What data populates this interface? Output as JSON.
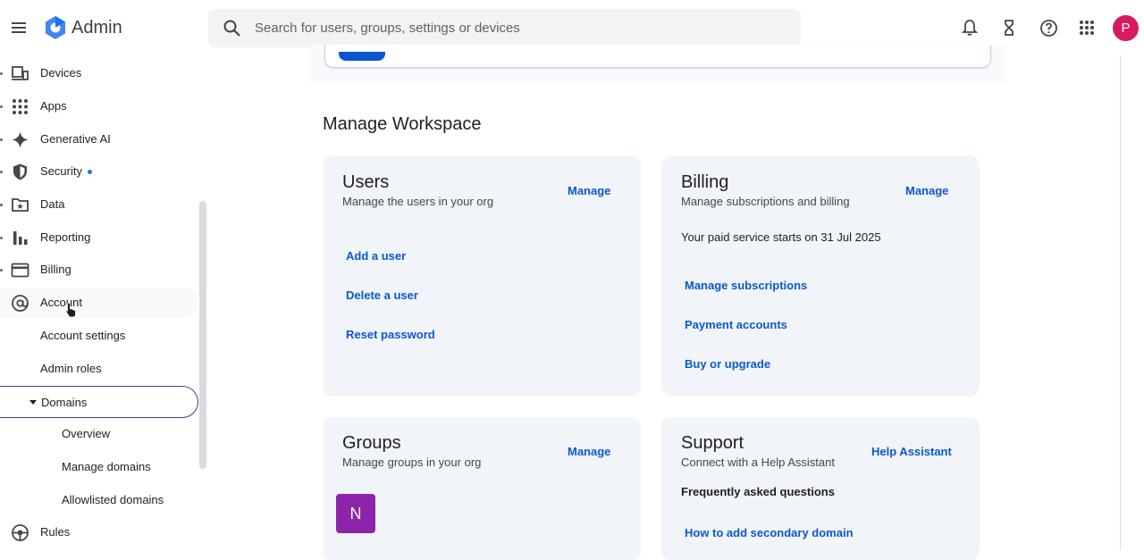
{
  "header": {
    "app_title": "Admin",
    "search_placeholder": "Search for users, groups, settings or devices",
    "avatar_initial": "P",
    "icons": [
      "menu-icon",
      "google-admin-logo",
      "search-icon",
      "bell-icon",
      "hourglass-icon",
      "help-icon",
      "apps-grid-icon"
    ]
  },
  "sidebar": {
    "items": [
      {
        "label": "Devices",
        "icon": "devices-icon"
      },
      {
        "label": "Apps",
        "icon": "apps-grid-icon"
      },
      {
        "label": "Generative AI",
        "icon": "sparkle-icon"
      },
      {
        "label": "Security",
        "icon": "shield-icon"
      },
      {
        "label": "Data",
        "icon": "folder-star-icon"
      },
      {
        "label": "Reporting",
        "icon": "bar-chart-icon"
      },
      {
        "label": "Billing",
        "icon": "credit-card-icon"
      },
      {
        "label": "Account",
        "icon": "at-sign-icon"
      }
    ],
    "account_sub": [
      "Account settings",
      "Admin roles"
    ],
    "domains": {
      "label": "Domains",
      "sub": [
        "Overview",
        "Manage domains",
        "Allowlisted domains"
      ]
    },
    "rules": {
      "label": "Rules",
      "icon": "rules-icon"
    }
  },
  "main": {
    "section_title": "Manage Workspace",
    "users_card": {
      "title": "Users",
      "subtitle": "Manage the users in your org",
      "manage": "Manage",
      "links": [
        "Add a user",
        "Delete a user",
        "Reset password"
      ]
    },
    "billing_card": {
      "title": "Billing",
      "subtitle": "Manage subscriptions and billing",
      "manage": "Manage",
      "status": "Your paid service starts on 31 Jul 2025",
      "links": [
        "Manage subscriptions",
        "Payment accounts",
        "Buy or upgrade"
      ]
    },
    "groups_card": {
      "title": "Groups",
      "subtitle": "Manage groups in your org",
      "manage": "Manage",
      "group_initial": "N"
    },
    "support_card": {
      "title": "Support",
      "subtitle": "Connect with a Help Assistant",
      "action": "Help Assistant",
      "faq_heading": "Frequently asked questions",
      "faq_link": "How to add secondary domain"
    }
  },
  "colors": {
    "accent": "#0b57d0",
    "avatar": "#d81b60",
    "group_avatar": "#8e24aa",
    "card_bg": "#f1f5f9"
  }
}
